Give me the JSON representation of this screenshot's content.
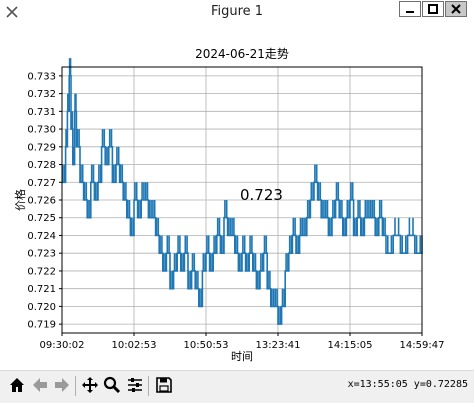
{
  "window": {
    "title": "Figure 1"
  },
  "toolbar": {
    "buttons": [
      "home-icon",
      "back-arrow-icon",
      "forward-arrow-icon",
      "pan-icon",
      "zoom-icon",
      "subplots-icon",
      "save-icon"
    ],
    "coords": "x=13:55:05 y=0.72285"
  },
  "chart_data": {
    "type": "line",
    "title": "2024-06-21走势",
    "xlabel": "时间",
    "ylabel": "价格",
    "color": "#1f77b4",
    "annotation": "0.723",
    "xticks": [
      "09:30:02",
      "10:02:53",
      "10:50:53",
      "13:23:41",
      "14:15:05",
      "14:59:47"
    ],
    "yticks": [
      "0.719",
      "0.720",
      "0.721",
      "0.722",
      "0.723",
      "0.724",
      "0.725",
      "0.726",
      "0.727",
      "0.728",
      "0.729",
      "0.730",
      "0.731",
      "0.732",
      "0.733"
    ],
    "ylim": [
      0.7185,
      0.7335
    ],
    "xlim": [
      0,
      1
    ],
    "grid": true,
    "series": [
      {
        "x": [
          0.0,
          0.01,
          0.015,
          0.02,
          0.025,
          0.03,
          0.035,
          0.04,
          0.05,
          0.06,
          0.07,
          0.08,
          0.09,
          0.1,
          0.11,
          0.12,
          0.13,
          0.14,
          0.15,
          0.16,
          0.17,
          0.18,
          0.19,
          0.2,
          0.21,
          0.22,
          0.23,
          0.24,
          0.25,
          0.26,
          0.27,
          0.28,
          0.29,
          0.3,
          0.31,
          0.32,
          0.33,
          0.34,
          0.35,
          0.36,
          0.37,
          0.38,
          0.39,
          0.4,
          0.41,
          0.42,
          0.43,
          0.44,
          0.45,
          0.46,
          0.47,
          0.48,
          0.49,
          0.5,
          0.51,
          0.52,
          0.53,
          0.54,
          0.55,
          0.56,
          0.57,
          0.58,
          0.59,
          0.6,
          0.61,
          0.62,
          0.63,
          0.64,
          0.65,
          0.66,
          0.67,
          0.68,
          0.69,
          0.7,
          0.71,
          0.72,
          0.73,
          0.74,
          0.75,
          0.76,
          0.77,
          0.78,
          0.79,
          0.8,
          0.81,
          0.82,
          0.83,
          0.84,
          0.85,
          0.86,
          0.87,
          0.88,
          0.89,
          0.9,
          0.92,
          0.94,
          0.96,
          0.98,
          1.0
        ],
        "y": [
          0.727,
          0.729,
          0.731,
          0.733,
          0.73,
          0.728,
          0.731,
          0.729,
          0.727,
          0.726,
          0.725,
          0.727,
          0.726,
          0.727,
          0.729,
          0.728,
          0.729,
          0.727,
          0.728,
          0.727,
          0.726,
          0.725,
          0.724,
          0.726,
          0.725,
          0.726,
          0.726,
          0.725,
          0.725,
          0.724,
          0.723,
          0.722,
          0.723,
          0.721,
          0.722,
          0.723,
          0.722,
          0.723,
          0.721,
          0.722,
          0.721,
          0.72,
          0.722,
          0.723,
          0.722,
          0.723,
          0.724,
          0.723,
          0.725,
          0.724,
          0.724,
          0.723,
          0.722,
          0.723,
          0.722,
          0.723,
          0.722,
          0.721,
          0.722,
          0.723,
          0.721,
          0.72,
          0.72,
          0.719,
          0.72,
          0.722,
          0.723,
          0.724,
          0.723,
          0.724,
          0.724,
          0.725,
          0.726,
          0.727,
          0.726,
          0.725,
          0.725,
          0.724,
          0.725,
          0.726,
          0.725,
          0.724,
          0.725,
          0.726,
          0.724,
          0.725,
          0.724,
          0.725,
          0.725,
          0.725,
          0.724,
          0.725,
          0.724,
          0.723,
          0.724,
          0.723,
          0.724,
          0.723,
          0.724
        ]
      }
    ]
  }
}
